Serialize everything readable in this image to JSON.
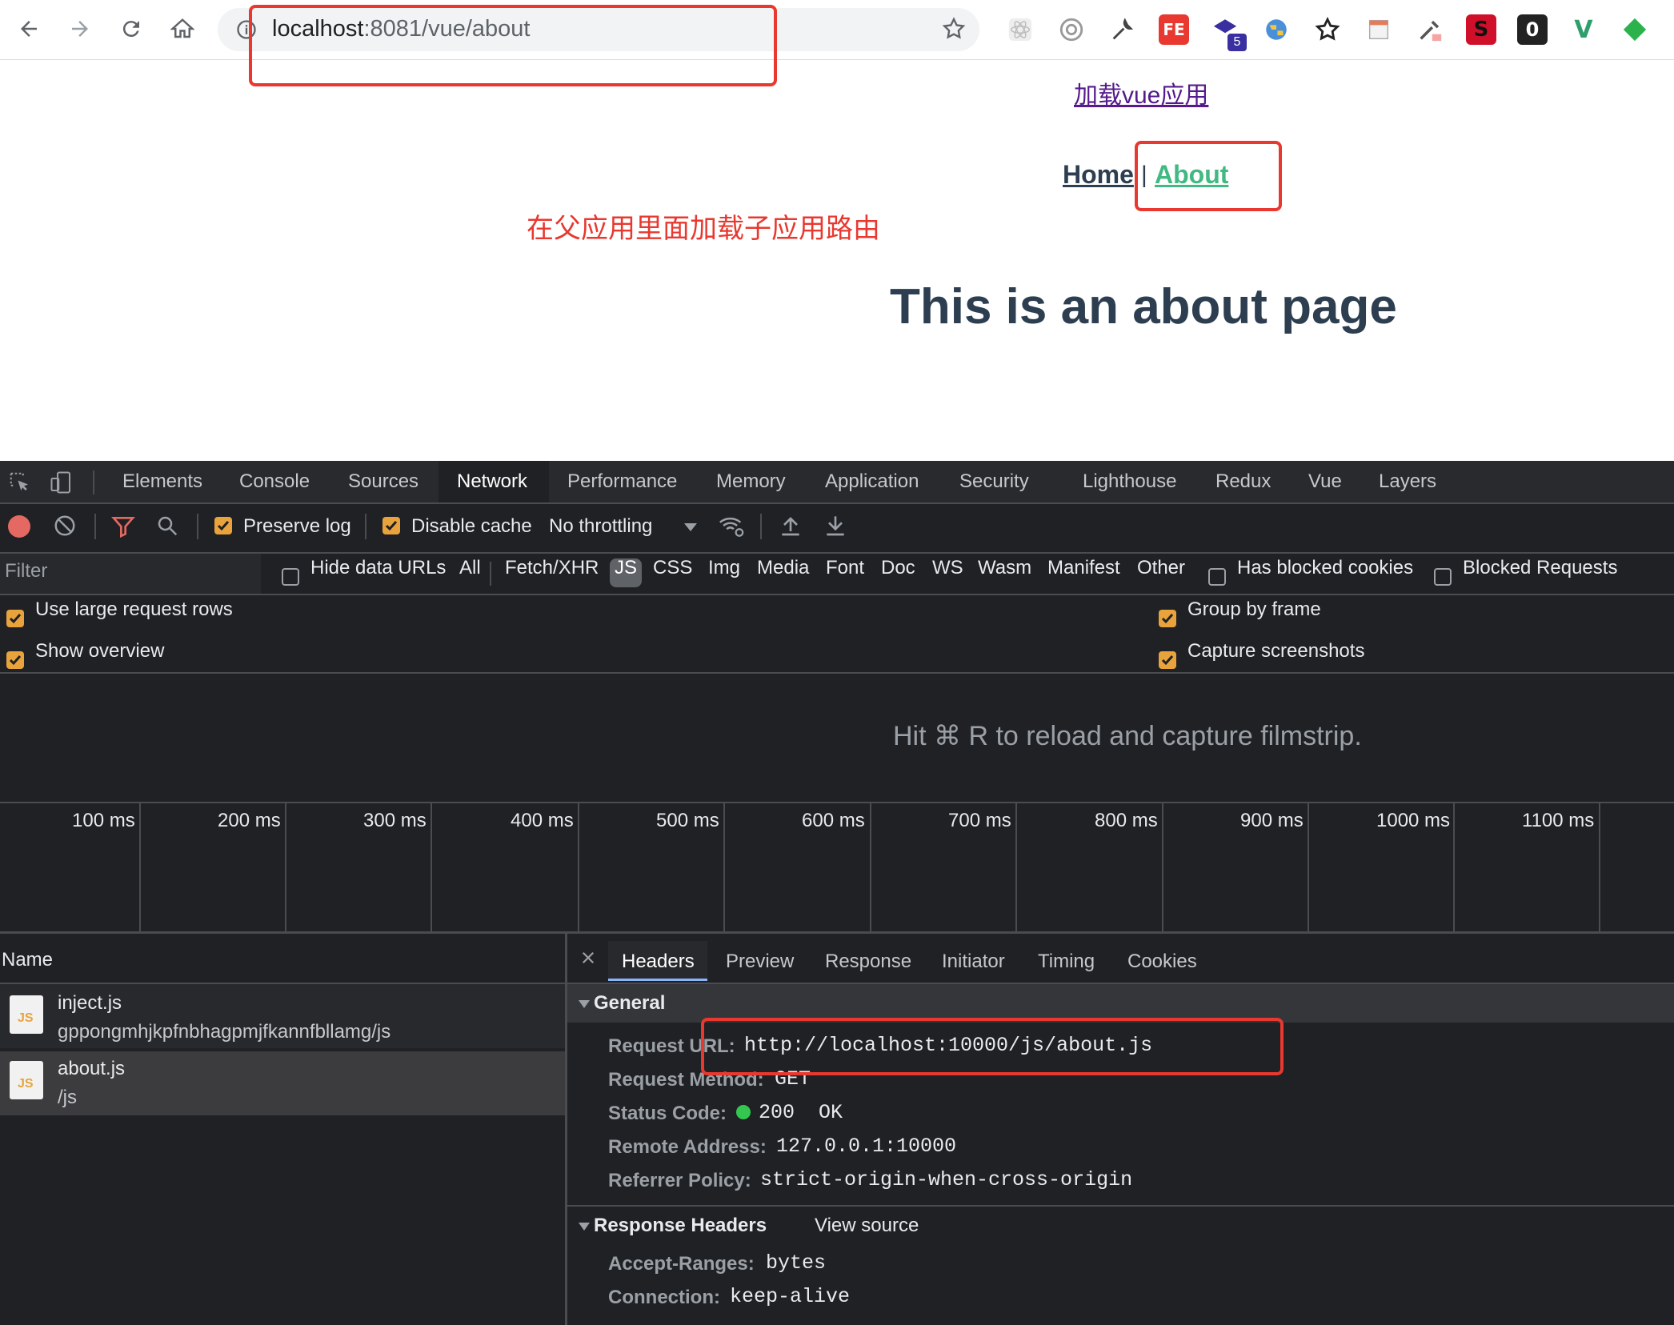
{
  "browser": {
    "url_host": "localhost",
    "url_rest": ":8081/vue/about",
    "extensions": [
      "react-icon",
      "target-icon",
      "wrench-icon",
      "fe-icon",
      "stack-icon",
      "globe-icon",
      "star-outline-icon",
      "note-icon",
      "eyedropper-icon",
      "s-icon",
      "zero-icon",
      "vue-icon",
      "feedly-icon"
    ],
    "ext_fe": "FE",
    "ext_badge": "5",
    "ext_s": "S",
    "ext_zero": "0",
    "ext_vue": "V"
  },
  "page": {
    "load_link": "加载vue应用",
    "nav_home": "Home",
    "nav_sep": "|",
    "nav_about": "About",
    "annotation": "在父应用里面加载子应用路由",
    "heading": "This is an about page"
  },
  "devtools": {
    "tabs": [
      "Elements",
      "Console",
      "Sources",
      "Network",
      "Performance",
      "Memory",
      "Application",
      "Security",
      "Lighthouse",
      "Redux",
      "Vue",
      "Layers"
    ],
    "active_tab": "Network",
    "toolbar": {
      "preserve_log": "Preserve log",
      "disable_cache": "Disable cache",
      "throttling": "No throttling"
    },
    "filter": {
      "placeholder": "Filter",
      "hide_data_urls": "Hide data URLs",
      "types": [
        "All",
        "Fetch/XHR",
        "JS",
        "CSS",
        "Img",
        "Media",
        "Font",
        "Doc",
        "WS",
        "Wasm",
        "Manifest",
        "Other"
      ],
      "active_type": "JS",
      "has_blocked_cookies": "Has blocked cookies",
      "blocked_requests": "Blocked Requests"
    },
    "settings": {
      "large_rows": "Use large request rows",
      "show_overview": "Show overview",
      "group_by_frame": "Group by frame",
      "capture_screenshots": "Capture screenshots"
    },
    "filmstrip_hint": "Hit ⌘ R to reload and capture filmstrip.",
    "timeline_ticks": [
      "100 ms",
      "200 ms",
      "300 ms",
      "400 ms",
      "500 ms",
      "600 ms",
      "700 ms",
      "800 ms",
      "900 ms",
      "1000 ms",
      "1100 ms"
    ],
    "name_header": "Name",
    "requests": [
      {
        "name": "inject.js",
        "path": "gppongmhjkpfnbhagpmjfkannfbllamg/js",
        "selected": false
      },
      {
        "name": "about.js",
        "path": "/js",
        "selected": true
      }
    ],
    "file_icon_label": "JS",
    "detail_tabs": [
      "Headers",
      "Preview",
      "Response",
      "Initiator",
      "Timing",
      "Cookies"
    ],
    "active_detail_tab": "Headers",
    "general": {
      "title": "General",
      "rows": [
        {
          "key": "Request URL:",
          "value": "http://localhost:10000/js/about.js"
        },
        {
          "key": "Request Method:",
          "value": "GET"
        },
        {
          "key": "Status Code:",
          "value": "200  OK"
        },
        {
          "key": "Remote Address:",
          "value": "127.0.0.1:10000"
        },
        {
          "key": "Referrer Policy:",
          "value": "strict-origin-when-cross-origin"
        }
      ]
    },
    "response_headers": {
      "title": "Response Headers",
      "view_source": "View source",
      "rows": [
        {
          "key": "Accept-Ranges:",
          "value": "bytes"
        },
        {
          "key": "Connection:",
          "value": "keep-alive"
        }
      ]
    }
  },
  "colors": {
    "annotation_red": "#e8382f",
    "vue_green": "#42b983",
    "heading": "#2c3e50",
    "devtools_bg": "#202124",
    "checkbox_orange": "#e8a33d"
  }
}
